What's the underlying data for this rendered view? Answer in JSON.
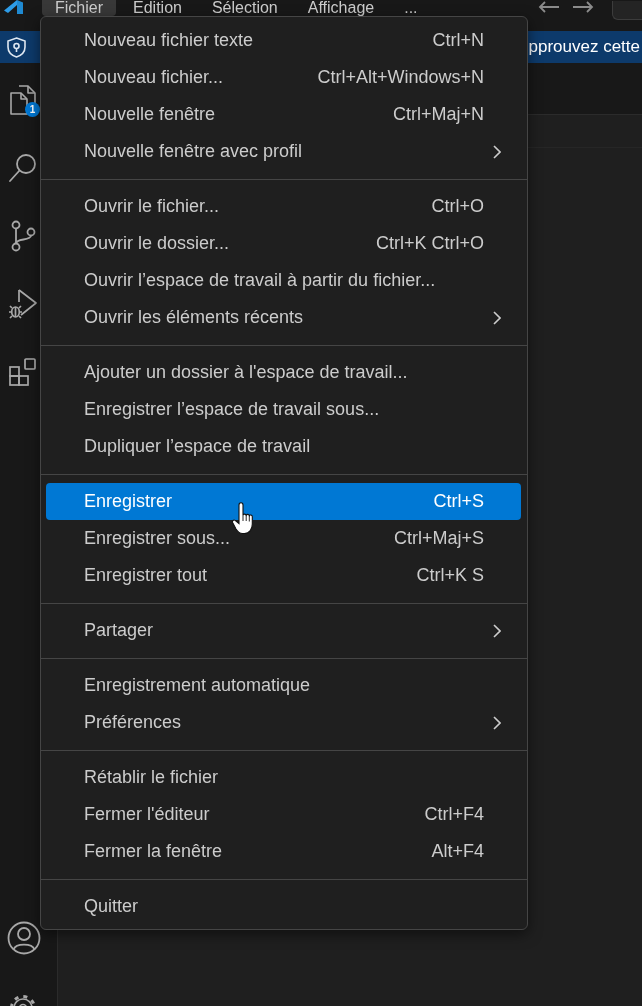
{
  "title_bar": {
    "menus": [
      {
        "label": "Fichier",
        "selected": true
      },
      {
        "label": "Edition",
        "selected": false
      },
      {
        "label": "Sélection",
        "selected": false
      },
      {
        "label": "Affichage",
        "selected": false
      },
      {
        "label": "...",
        "selected": false
      }
    ]
  },
  "banner": {
    "text": "pprouvez cette"
  },
  "activity_bar": {
    "explorer_badge": "1"
  },
  "file_menu": {
    "groups": [
      {
        "items": [
          {
            "label": "Nouveau fichier texte",
            "shortcut": "Ctrl+N",
            "submenu": false,
            "selected": false
          },
          {
            "label": "Nouveau fichier...",
            "shortcut": "Ctrl+Alt+Windows+N",
            "submenu": false,
            "selected": false
          },
          {
            "label": "Nouvelle fenêtre",
            "shortcut": "Ctrl+Maj+N",
            "submenu": false,
            "selected": false
          },
          {
            "label": "Nouvelle fenêtre avec profil",
            "submenu": true,
            "selected": false
          }
        ]
      },
      {
        "items": [
          {
            "label": "Ouvrir le fichier...",
            "shortcut": "Ctrl+O",
            "submenu": false,
            "selected": false
          },
          {
            "label": "Ouvrir le dossier...",
            "shortcut": "Ctrl+K Ctrl+O",
            "submenu": false,
            "selected": false
          },
          {
            "label": "Ouvrir l’espace de travail à partir du fichier...",
            "submenu": false,
            "selected": false
          },
          {
            "label": "Ouvrir les éléments récents",
            "submenu": true,
            "selected": false
          }
        ]
      },
      {
        "items": [
          {
            "label": "Ajouter un dossier à l'espace de travail...",
            "submenu": false,
            "selected": false
          },
          {
            "label": "Enregistrer l’espace de travail sous...",
            "submenu": false,
            "selected": false
          },
          {
            "label": "Dupliquer l’espace de travail",
            "submenu": false,
            "selected": false
          }
        ]
      },
      {
        "items": [
          {
            "label": "Enregistrer",
            "shortcut": "Ctrl+S",
            "submenu": false,
            "selected": true
          },
          {
            "label": "Enregistrer sous...",
            "shortcut": "Ctrl+Maj+S",
            "submenu": false,
            "selected": false
          },
          {
            "label": "Enregistrer tout",
            "shortcut": "Ctrl+K S",
            "submenu": false,
            "selected": false
          }
        ]
      },
      {
        "items": [
          {
            "label": "Partager",
            "submenu": true,
            "selected": false
          }
        ]
      },
      {
        "items": [
          {
            "label": "Enregistrement automatique",
            "submenu": false,
            "selected": false
          },
          {
            "label": "Préférences",
            "submenu": true,
            "selected": false
          }
        ]
      },
      {
        "items": [
          {
            "label": "Rétablir le fichier",
            "submenu": false,
            "selected": false
          },
          {
            "label": "Fermer l'éditeur",
            "shortcut": "Ctrl+F4",
            "submenu": false,
            "selected": false
          },
          {
            "label": "Fermer la fenêtre",
            "shortcut": "Alt+F4",
            "submenu": false,
            "selected": false
          }
        ]
      },
      {
        "items": [
          {
            "label": "Quitter",
            "submenu": false,
            "selected": false
          }
        ]
      }
    ]
  }
}
